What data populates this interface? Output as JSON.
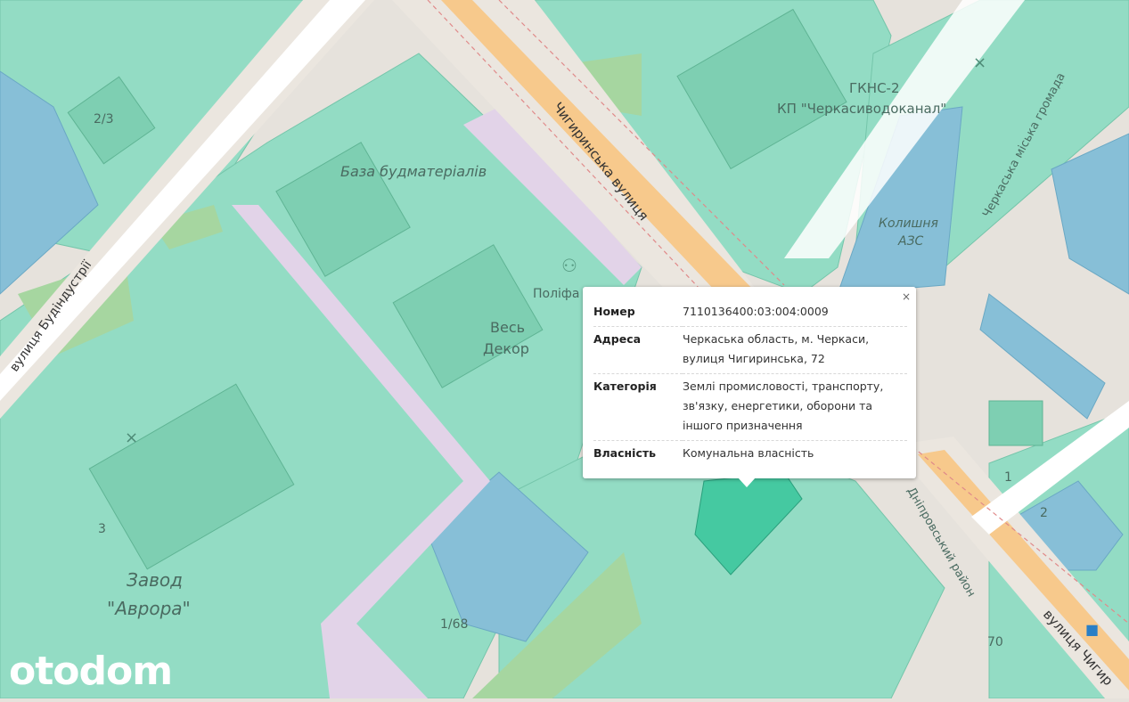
{
  "map": {
    "labels": {
      "street_chyhyrynska_upper": "Чигиринська вулиця",
      "street_chyhyrynska_lower": "вулиця Чигир",
      "street_budindustrii": "вулиця Будіндустрії",
      "base_materials": "База будматеріалів",
      "gkns_line1": "ГКНС-2",
      "gkns_line2": "КП \"Черкасиводоканал\"",
      "former_gas_line1": "Колишня",
      "former_gas_line2": "АЗС",
      "polifa": "Поліфа",
      "ves_dekor_line1": "Весь",
      "ves_dekor_line2": "Декор",
      "zavod_line1": "Завод",
      "zavod_line2": "\"Аврора\"",
      "city_community": "Черкаська міська громада",
      "district": "Дніпровський район",
      "num_2_3": "2/3",
      "num_3": "3",
      "num_1_68": "1/68",
      "num_70": "70",
      "num_1": "1",
      "num_2": "2"
    },
    "colors": {
      "parcel_green": "#8fdcc3",
      "parcel_blue": "#87bfd7",
      "road_major": "#f7c98c",
      "road_white": "#ffffff",
      "selected_parcel": "#45c9a1",
      "pedestrian": "#e2d3e8",
      "park": "#a6d6a0"
    }
  },
  "popup": {
    "close": "×",
    "rows": [
      {
        "key": "Номер",
        "value": "7110136400:03:004:0009"
      },
      {
        "key": "Адреса",
        "value": "Черкаська область, м. Черкаси, вулиця Чигиринська, 72"
      },
      {
        "key": "Категорія",
        "value": "Землі промисловості, транспорту, зв'язку, енергетики, оборони та іншого призначення"
      },
      {
        "key": "Власність",
        "value": "Комунальна власність"
      }
    ]
  },
  "watermark": "otodom"
}
